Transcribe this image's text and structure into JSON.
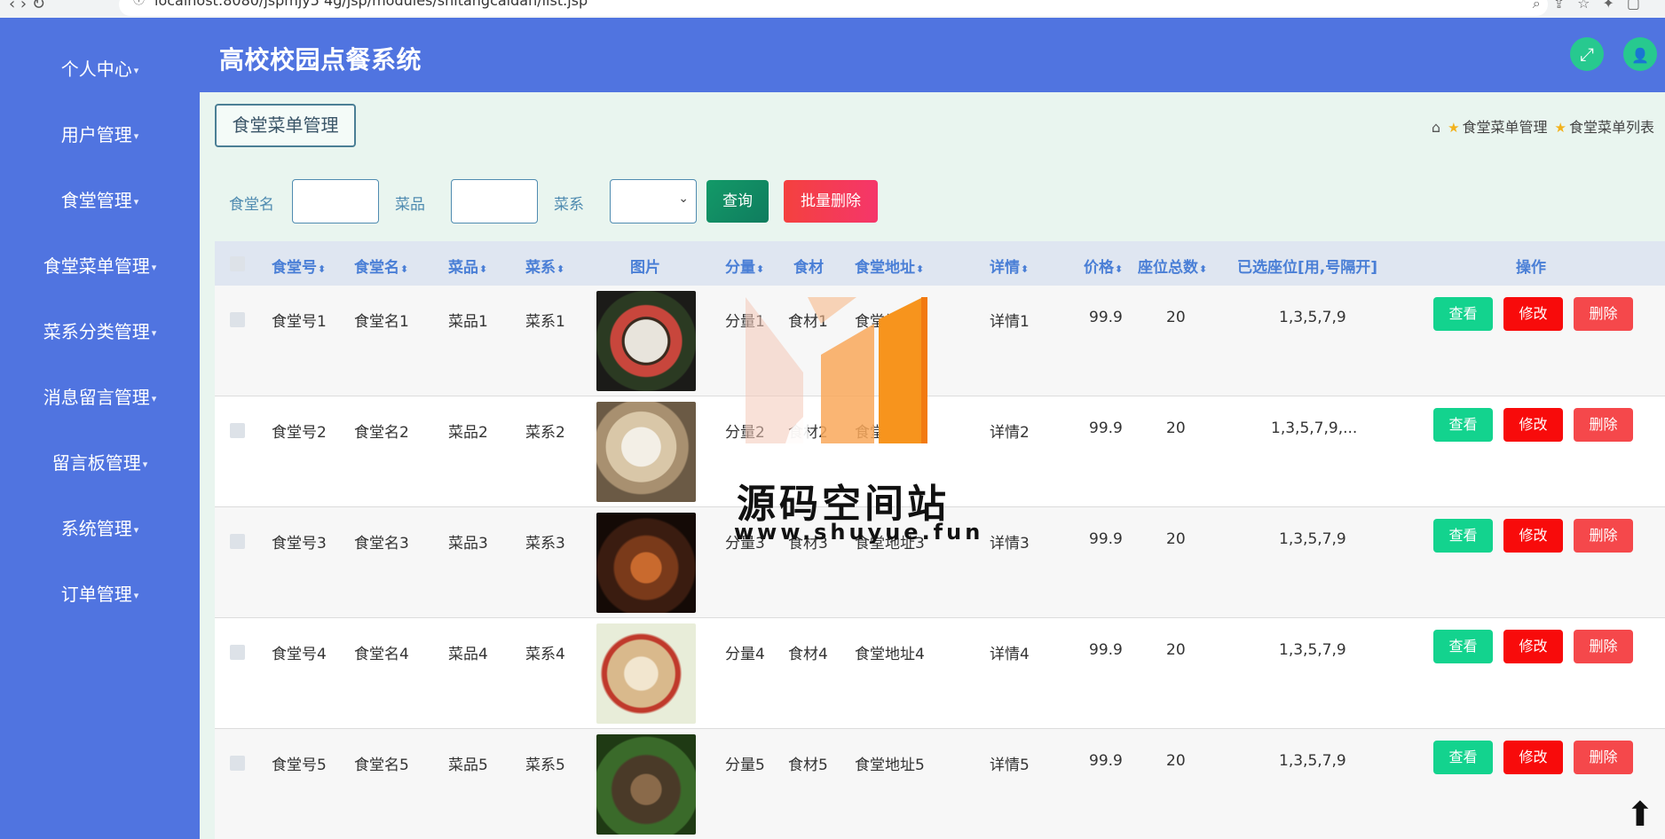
{
  "browser": {
    "url": "localhost:8080/jspmjy5 4g/jsp/modules/shitangcaidan/list.jsp"
  },
  "app": {
    "title": "高校校园点餐系统"
  },
  "sidebar": {
    "items": [
      {
        "label": "个人中心"
      },
      {
        "label": "用户管理"
      },
      {
        "label": "食堂管理"
      },
      {
        "label": "食堂菜单管理"
      },
      {
        "label": "菜系分类管理"
      },
      {
        "label": "消息留言管理"
      },
      {
        "label": "留言板管理"
      },
      {
        "label": "系统管理"
      },
      {
        "label": "订单管理"
      }
    ]
  },
  "header": {
    "fullscreen_icon": "⤢",
    "user_icon": "👤"
  },
  "page": {
    "tab_label": "食堂菜单管理",
    "breadcrumb": {
      "level1": "食堂菜单管理",
      "level2": "食堂菜单列表"
    }
  },
  "search": {
    "canteen_label": "食堂名",
    "dish_label": "菜品",
    "cuisine_label": "菜系",
    "query_label": "查询",
    "batch_delete_label": "批量删除"
  },
  "table": {
    "headers": [
      "食堂号",
      "食堂名",
      "菜品",
      "菜系",
      "图片",
      "分量",
      "食材",
      "食堂地址",
      "详情",
      "价格",
      "座位总数",
      "已选座位[用,号隔开]",
      "操作"
    ],
    "actions": {
      "view": "查看",
      "edit": "修改",
      "delete": "删除"
    },
    "rows": [
      {
        "id": "食堂号1",
        "name": "食堂名1",
        "dish": "菜品1",
        "cuisine": "菜系1",
        "portion": "分量1",
        "ingredient": "食材1",
        "address": "食堂地址1",
        "detail": "详情1",
        "price": "99.9",
        "seats": "20",
        "selected": "1,3,5,7,9"
      },
      {
        "id": "食堂号2",
        "name": "食堂名2",
        "dish": "菜品2",
        "cuisine": "菜系2",
        "portion": "分量2",
        "ingredient": "食材2",
        "address": "食堂地址2",
        "detail": "详情2",
        "price": "99.9",
        "seats": "20",
        "selected": "1,3,5,7,9,..."
      },
      {
        "id": "食堂号3",
        "name": "食堂名3",
        "dish": "菜品3",
        "cuisine": "菜系3",
        "portion": "分量3",
        "ingredient": "食材3",
        "address": "食堂地址3",
        "detail": "详情3",
        "price": "99.9",
        "seats": "20",
        "selected": "1,3,5,7,9"
      },
      {
        "id": "食堂号4",
        "name": "食堂名4",
        "dish": "菜品4",
        "cuisine": "菜系4",
        "portion": "分量4",
        "ingredient": "食材4",
        "address": "食堂地址4",
        "detail": "详情4",
        "price": "99.9",
        "seats": "20",
        "selected": "1,3,5,7,9"
      },
      {
        "id": "食堂号5",
        "name": "食堂名5",
        "dish": "菜品5",
        "cuisine": "菜系5",
        "portion": "分量5",
        "ingredient": "食材5",
        "address": "食堂地址5",
        "detail": "详情5",
        "price": "99.9",
        "seats": "20",
        "selected": "1,3,5,7,9"
      }
    ]
  },
  "watermark": {
    "text": "源码空间站",
    "url": "www.shuyue.fun"
  },
  "colors": {
    "primary": "#5074e0",
    "content_bg": "#e9f5ef",
    "view": "#13d38e",
    "edit": "#f80b0b",
    "delete": "#f5484b"
  }
}
